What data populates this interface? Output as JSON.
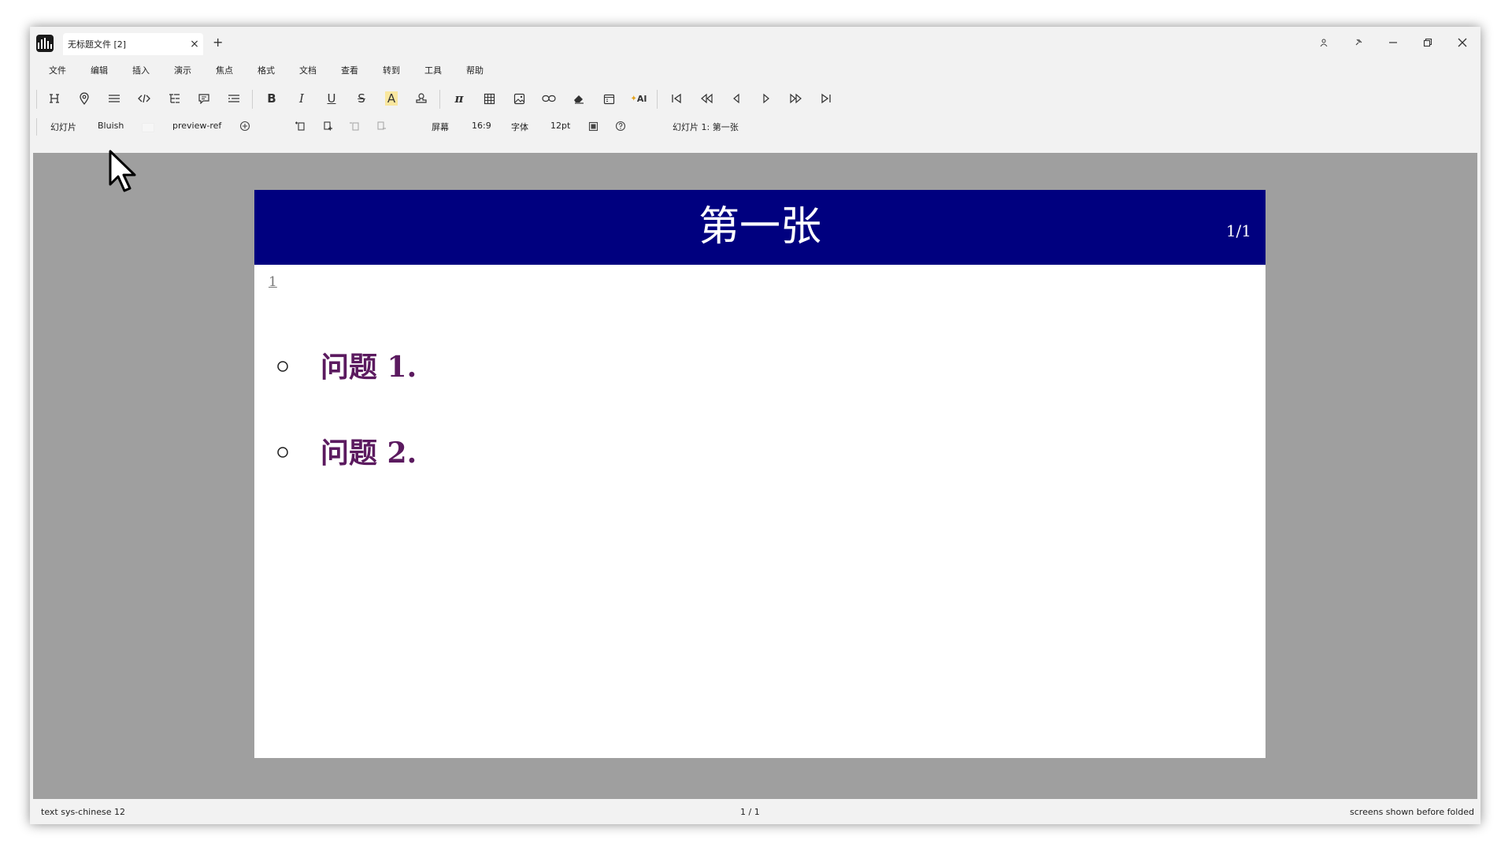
{
  "window": {
    "tab_title": "无标题文件 [2]",
    "tab_close": "×",
    "tab_add": "+"
  },
  "menu": [
    "文件",
    "编辑",
    "插入",
    "演示",
    "焦点",
    "格式",
    "文档",
    "查看",
    "转到",
    "工具",
    "帮助"
  ],
  "toolbar": {
    "bold": "B",
    "italic": "I",
    "underline": "U",
    "strike": "S",
    "highlight": "A",
    "pi": "π",
    "ai": "AI"
  },
  "secondary_bar": {
    "mode": "幻灯片",
    "theme": "Bluish",
    "preview": "preview-ref",
    "screen": "屏幕",
    "ratio": "16:9",
    "font_label": "字体",
    "font_size": "12pt",
    "slide_info": "幻灯片 1: 第一张"
  },
  "slide": {
    "title": "第一张",
    "page": "1/1",
    "line_number": "1",
    "bullets": [
      "问题 1.",
      "问题 2."
    ]
  },
  "status": {
    "left": "text sys-chinese 12",
    "middle": "1 / 1",
    "right": "screens shown before folded"
  },
  "colors": {
    "slide_header": "#00007f",
    "bullet_text": "#5b1a5f",
    "canvas_bg": "#9f9f9f",
    "highlight": "#f9e79f"
  }
}
